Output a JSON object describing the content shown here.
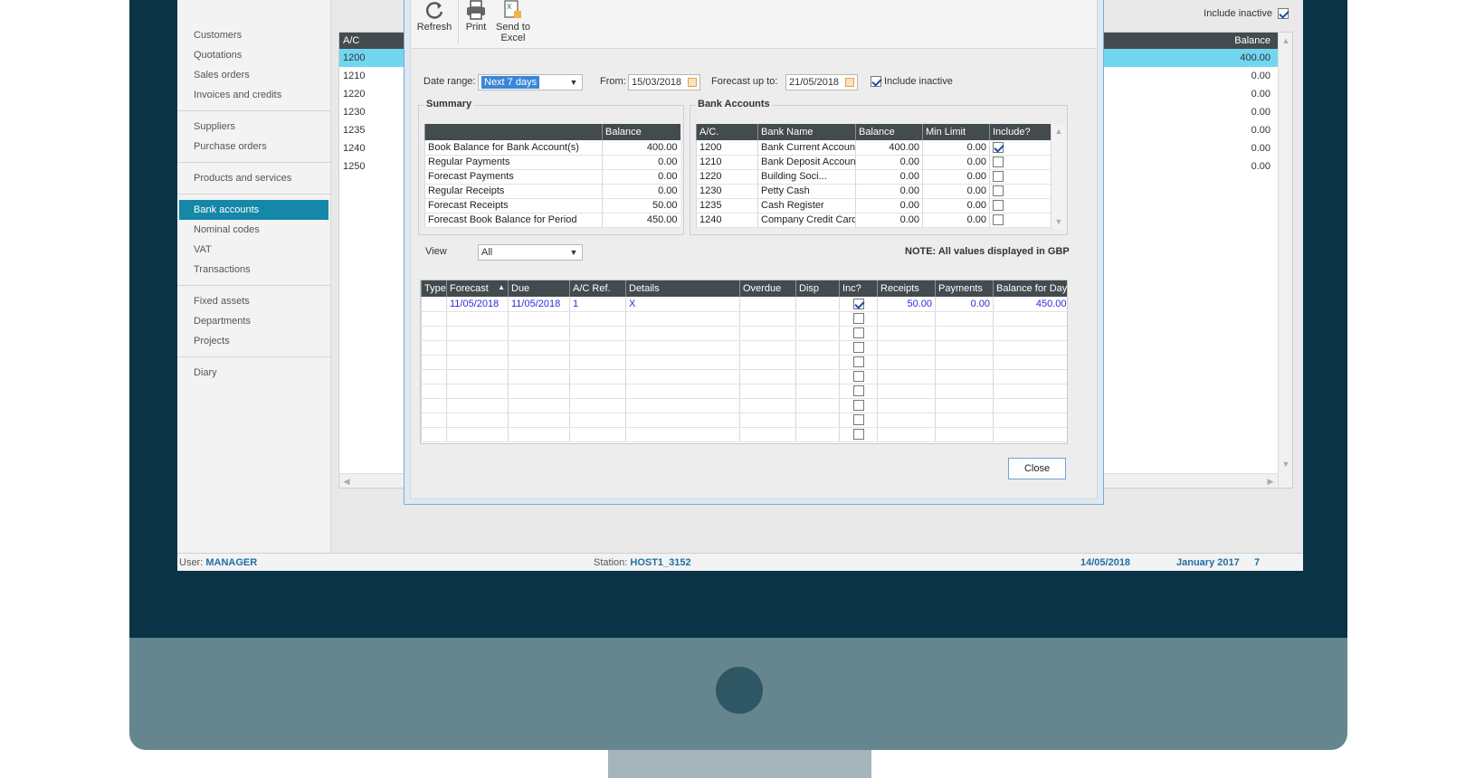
{
  "sidebar": {
    "groups": [
      [
        "Customers",
        "Quotations",
        "Sales orders",
        "Invoices and credits"
      ],
      [
        "Suppliers",
        "Purchase orders"
      ],
      [
        "Products and services"
      ],
      [
        "Bank accounts",
        "Nominal codes",
        "VAT",
        "Transactions"
      ],
      [
        "Fixed assets",
        "Departments",
        "Projects"
      ],
      [
        "Diary"
      ]
    ],
    "active": "Bank accounts"
  },
  "background_list": {
    "include_inactive_label": "Include inactive",
    "columns": {
      "ac": "A/C",
      "balance": "Balance"
    },
    "rows": [
      {
        "ac": "1200",
        "balance": "400.00"
      },
      {
        "ac": "1210",
        "balance": "0.00"
      },
      {
        "ac": "1220",
        "balance": "0.00"
      },
      {
        "ac": "1230",
        "balance": "0.00"
      },
      {
        "ac": "1235",
        "balance": "0.00"
      },
      {
        "ac": "1240",
        "balance": "0.00"
      },
      {
        "ac": "1250",
        "balance": "0.00"
      }
    ]
  },
  "dialog": {
    "toolbar": {
      "refresh": "Refresh",
      "print": "Print",
      "send_to_excel_1": "Send to",
      "send_to_excel_2": "Excel"
    },
    "date_range_label": "Date range:",
    "date_range_value": "Next 7 days",
    "from_label": "From:",
    "from_value": "15/03/2018",
    "forecast_label": "Forecast up to:",
    "forecast_value": "21/05/2018",
    "include_inactive_label": "Include inactive",
    "summary": {
      "title": "Summary",
      "balance_header": "Balance",
      "rows": [
        {
          "label": "Book Balance for Bank Account(s)",
          "value": "400.00"
        },
        {
          "label": "Regular Payments",
          "value": "0.00"
        },
        {
          "label": "Forecast Payments",
          "value": "0.00"
        },
        {
          "label": "Regular Receipts",
          "value": "0.00"
        },
        {
          "label": "Forecast Receipts",
          "value": "50.00"
        },
        {
          "label": "Forecast Book Balance for Period",
          "value": "450.00"
        }
      ]
    },
    "bank_accounts": {
      "title": "Bank Accounts",
      "headers": [
        "A/C.",
        "Bank Name",
        "Balance",
        "Min Limit",
        "Include?"
      ],
      "rows": [
        {
          "ac": "1200",
          "name": "Bank Current Account",
          "balance": "400.00",
          "min": "0.00"
        },
        {
          "ac": "1210",
          "name": "Bank Deposit Account",
          "balance": "0.00",
          "min": "0.00"
        },
        {
          "ac": "1220",
          "name": "Building Soci...",
          "balance": "0.00",
          "min": "0.00"
        },
        {
          "ac": "1230",
          "name": "Petty Cash",
          "balance": "0.00",
          "min": "0.00"
        },
        {
          "ac": "1235",
          "name": "Cash Register",
          "balance": "0.00",
          "min": "0.00"
        },
        {
          "ac": "1240",
          "name": "Company Credit Card",
          "balance": "0.00",
          "min": "0.00"
        }
      ]
    },
    "view_label": "View",
    "view_value": "All",
    "note": "NOTE: All values displayed in GBP",
    "forecast_table": {
      "headers": [
        "Type",
        "Forecast",
        "Due",
        "A/C Ref.",
        "Details",
        "Overdue",
        "Disp",
        "Inc?",
        "Receipts",
        "Payments",
        "Balance for Day"
      ],
      "row": {
        "type": "",
        "forecast": "11/05/2018",
        "due": "11/05/2018",
        "ac_ref": "1",
        "details": "X",
        "overdue": "",
        "disp": "",
        "receipts": "50.00",
        "payments": "0.00",
        "balance": "450.00"
      }
    },
    "close_label": "Close"
  },
  "status": {
    "user_label": "User:",
    "user_value": "MANAGER",
    "station_label": "Station:",
    "station_value": "HOST1_3152",
    "date": "14/05/2018",
    "period": "January 2017",
    "period_num": "7"
  }
}
